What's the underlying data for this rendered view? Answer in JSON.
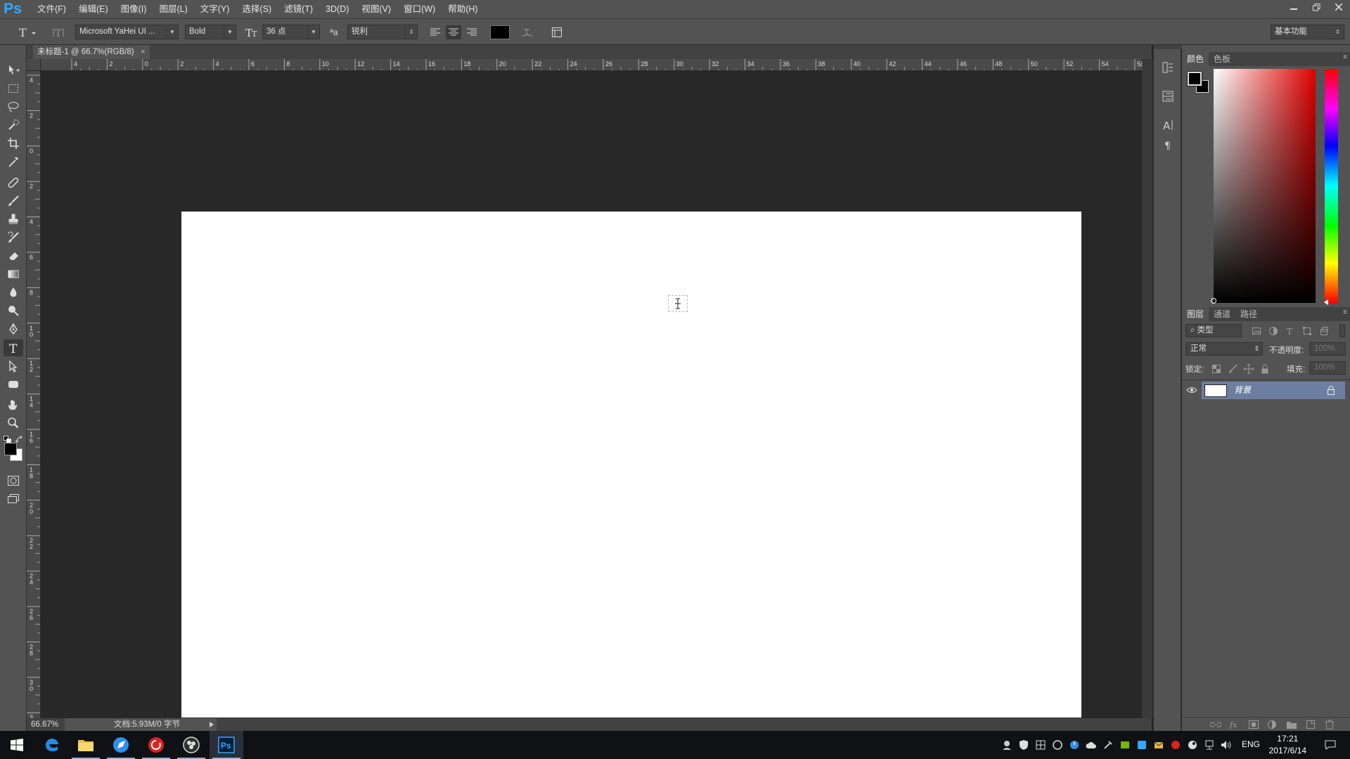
{
  "app": {
    "logo": "Ps",
    "menu": [
      "文件(F)",
      "编辑(E)",
      "图像(I)",
      "图层(L)",
      "文字(Y)",
      "选择(S)",
      "滤镜(T)",
      "3D(D)",
      "视图(V)",
      "窗口(W)",
      "帮助(H)"
    ]
  },
  "options": {
    "font_family": "Microsoft YaHei UI ...",
    "font_style": "Bold",
    "font_size": "36 点",
    "antialias_icon_text": "ªa",
    "antialias": "锐利",
    "text_color": "#000000",
    "workspace": "基本功能"
  },
  "document": {
    "tab_title": "未标题-1 @ 66.7%(RGB/8)",
    "close": "×",
    "canvas_color": "#ffffff"
  },
  "rulers": {
    "h_labels": [
      "4",
      "2",
      "0",
      "2",
      "4",
      "6",
      "8",
      "10",
      "12",
      "14",
      "16",
      "18",
      "20",
      "22",
      "24",
      "26",
      "28",
      "30",
      "32",
      "34",
      "36",
      "38",
      "40",
      "42",
      "44",
      "46",
      "48",
      "50",
      "52",
      "54",
      "5("
    ],
    "v_labels": [
      "4",
      "2",
      "0",
      "2",
      "4",
      "6",
      "8",
      "10",
      "12",
      "14",
      "16",
      "18",
      "20",
      "22",
      "24",
      "26",
      "28",
      "30",
      "3"
    ]
  },
  "status": {
    "zoom": "66.67%",
    "doc_info": "文档:5.93M/0 字节"
  },
  "panels": {
    "color_tabs": [
      "颜色",
      "色板"
    ],
    "layer_tabs": [
      "图层",
      "通道",
      "路径"
    ],
    "filter_kind": "类型",
    "blend_mode": "正常",
    "opacity_label": "不透明度:",
    "opacity_value": "100%",
    "lock_label": "锁定:",
    "fill_label": "填充:",
    "fill_value": "100%",
    "layer_name": "背景",
    "fg_color": "#000000",
    "bg_color": "#ffffff"
  },
  "dock_icons": [
    "history-icon",
    "properties-icon",
    "character-icon",
    "paragraph-icon"
  ],
  "tools": [
    "move",
    "marquee",
    "lasso",
    "quick-select",
    "crop",
    "eyedropper",
    "healing",
    "brush",
    "stamp",
    "history-brush",
    "eraser",
    "gradient",
    "blur",
    "dodge",
    "pen",
    "type",
    "path-select",
    "shape",
    "hand",
    "zoom"
  ],
  "taskbar": {
    "apps": [
      "start",
      "edge",
      "explorer",
      "browser",
      "netease-music",
      "obs",
      "photoshop"
    ],
    "lang": "ENG",
    "time": "17:21",
    "date": "2017/6/14"
  }
}
